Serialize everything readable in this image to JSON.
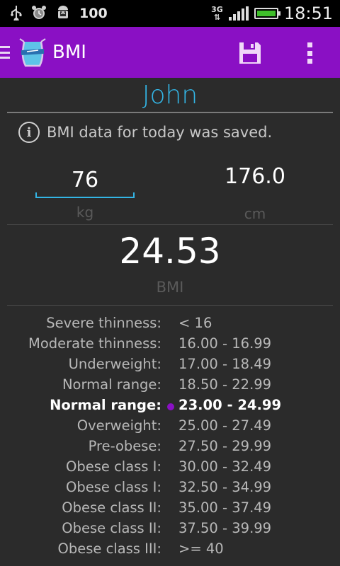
{
  "statusbar": {
    "battery_level": "100",
    "network_type": "3G",
    "time": "18:51",
    "icons": [
      "usb-icon",
      "alarm-icon",
      "android-debug-icon"
    ]
  },
  "actionbar": {
    "title": "BMI",
    "background_color": "#8a10c4",
    "actions": [
      "save-icon",
      "overflow-menu-icon"
    ]
  },
  "profile": {
    "name": "John",
    "name_color": "#33b5e5"
  },
  "notice": {
    "text": "BMI data for today was saved."
  },
  "inputs": {
    "weight": {
      "value": "76",
      "unit": "kg"
    },
    "height": {
      "value": "176.0",
      "unit": "cm"
    }
  },
  "result": {
    "value": "24.53",
    "label": "BMI"
  },
  "categories": [
    {
      "label": "Severe thinness:",
      "range": "< 16"
    },
    {
      "label": "Moderate thinness:",
      "range": "16.00 - 16.99"
    },
    {
      "label": "Underweight:",
      "range": "17.00 - 18.49"
    },
    {
      "label": "Normal range:",
      "range": "18.50 - 22.99"
    },
    {
      "label": "Normal range:",
      "range": "23.00 - 24.99",
      "active": true
    },
    {
      "label": "Overweight:",
      "range": "25.00 - 27.49"
    },
    {
      "label": "Pre-obese:",
      "range": "27.50 - 29.99"
    },
    {
      "label": "Obese class I:",
      "range": "30.00 - 32.49"
    },
    {
      "label": "Obese class I:",
      "range": "32.50 - 34.99"
    },
    {
      "label": "Obese class II:",
      "range": "35.00 - 37.49"
    },
    {
      "label": "Obese class II:",
      "range": "37.50 - 39.99"
    },
    {
      "label": "Obese class III:",
      "range": ">= 40"
    }
  ]
}
